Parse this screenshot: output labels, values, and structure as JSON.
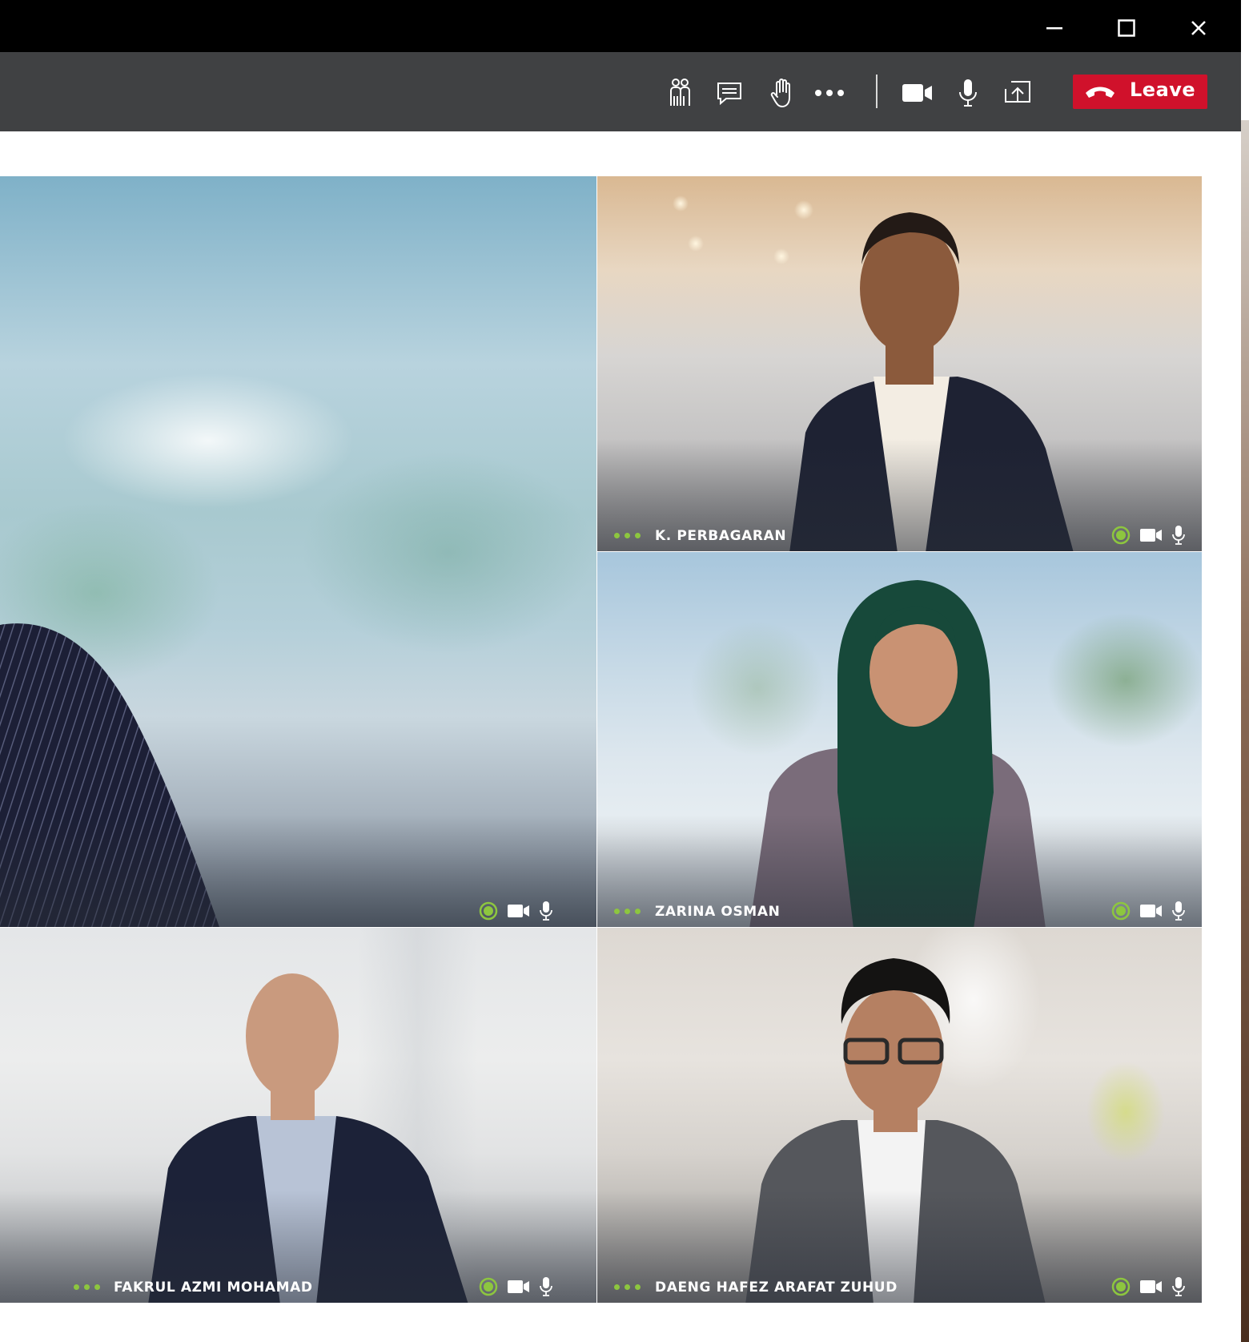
{
  "window_controls": {
    "minimize": "minimize",
    "maximize": "maximize",
    "close": "close"
  },
  "toolbar": {
    "icons": [
      "participants-icon",
      "chat-icon",
      "raise-hand-icon",
      "more-options-icon",
      "camera-icon",
      "microphone-icon",
      "share-screen-icon"
    ],
    "leave_label": "Leave",
    "leave_color": "#d0112b",
    "background": "#404143"
  },
  "participants": [
    {
      "name": "",
      "status": [
        "status-indicator-icon",
        "camera-icon",
        "microphone-icon"
      ]
    },
    {
      "name": "K. PERBAGARAN",
      "status": [
        "status-indicator-icon",
        "camera-icon",
        "microphone-icon"
      ]
    },
    {
      "name": "ZARINA OSMAN",
      "status": [
        "status-indicator-icon",
        "camera-icon",
        "microphone-icon"
      ]
    },
    {
      "name": "FAKRUL AZMI MOHAMAD",
      "status": [
        "status-indicator-icon",
        "camera-icon",
        "microphone-icon"
      ]
    },
    {
      "name": "DAENG HAFEZ ARAFAT ZUHUD",
      "status": [
        "status-indicator-icon",
        "camera-icon",
        "microphone-icon"
      ]
    }
  ],
  "colors": {
    "active_indicator": "#8dc63f",
    "title_bar": "#000000"
  }
}
